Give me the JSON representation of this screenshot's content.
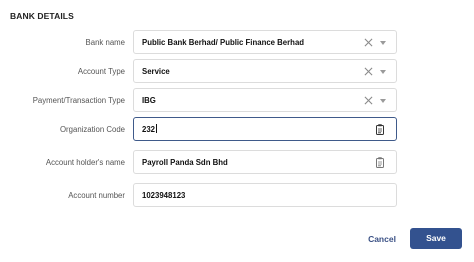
{
  "section": {
    "title": "BANK DETAILS"
  },
  "fields": [
    {
      "label": "Bank name",
      "value": "Public Bank Berhad/ Public Finance Berhad"
    },
    {
      "label": "Account Type",
      "value": "Service"
    },
    {
      "label": "Payment/Transaction Type",
      "value": "IBG"
    },
    {
      "label": "Organization Code",
      "value": "232"
    },
    {
      "label": "Account holder's name",
      "value": "Payroll Panda Sdn Bhd"
    },
    {
      "label": "Account number",
      "value": "1023948123"
    }
  ],
  "actions": {
    "cancel_label": "Cancel",
    "save_label": "Save"
  },
  "colors": {
    "primary": "#33528f",
    "focus_border": "#3f5a8a",
    "border": "#dcdcdc"
  },
  "icons": {
    "clear": "close-icon",
    "dropdown": "chevron-down-icon",
    "document": "document-icon"
  }
}
